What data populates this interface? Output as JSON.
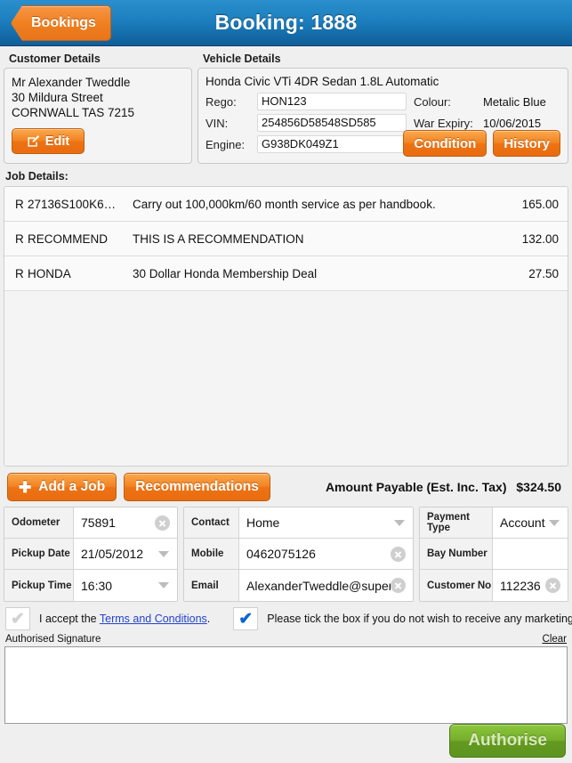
{
  "header": {
    "back_label": "Bookings",
    "title": "Booking: 1888"
  },
  "customer": {
    "panel_title": "Customer Details",
    "name": "Mr Alexander Tweddle",
    "street": "30 Mildura Street",
    "city_line": "CORNWALL TAS 7215",
    "edit_label": "Edit"
  },
  "vehicle": {
    "panel_title": "Vehicle Details",
    "description": "Honda Civic VTi 4DR Sedan 1.8L Automatic",
    "rego_label": "Rego:",
    "rego_value": "HON123",
    "vin_label": "VIN:",
    "vin_value": "254856D58548SD585",
    "engine_label": "Engine:",
    "engine_value": "G938DK049Z1",
    "colour_label": "Colour:",
    "colour_value": "Metalic Blue",
    "war_expiry_label": "War Expiry:",
    "war_expiry_value": "10/06/2015",
    "condition_label": "Condition",
    "history_label": "History"
  },
  "jobs": {
    "heading": "Job Details:",
    "rows": [
      {
        "flag": "R",
        "code": "27136S100K6…",
        "description": "Carry out 100,000km/60 month service as per handbook.",
        "price": "165.00"
      },
      {
        "flag": "R",
        "code": "RECOMMEND",
        "description": "THIS IS A RECOMMENDATION",
        "price": "132.00"
      },
      {
        "flag": "R",
        "code": "HONDA",
        "description": "30 Dollar Honda Membership Deal",
        "price": "27.50"
      }
    ]
  },
  "actions": {
    "add_job_label": "Add a Job",
    "add_job_icon": "plus-icon",
    "recommendations_label": "Recommendations",
    "amount_label": "Amount Payable (Est. Inc. Tax)",
    "amount_value": "$324.50"
  },
  "form": {
    "col1": [
      {
        "label": "Odometer",
        "value": "75891",
        "control": "clear"
      },
      {
        "label": "Pickup Date",
        "value": "21/05/2012",
        "control": "dropdown"
      },
      {
        "label": "Pickup Time",
        "value": "16:30",
        "control": "dropdown"
      }
    ],
    "col2": [
      {
        "label": "Contact",
        "value": "Home",
        "control": "dropdown"
      },
      {
        "label": "Mobile",
        "value": "0462075126",
        "control": "clear"
      },
      {
        "label": "Email",
        "value": "AlexanderTweddle@super",
        "control": "clear"
      }
    ],
    "col3": [
      {
        "label": "Payment Type",
        "value": "Account",
        "control": "dropdown"
      },
      {
        "label": "Bay Number",
        "value": "",
        "control": "none"
      },
      {
        "label": "Customer No",
        "value": "112236",
        "control": "clear"
      }
    ]
  },
  "terms": {
    "accept_prefix": "I accept the ",
    "accept_link": "Terms and Conditions",
    "accept_suffix": ".",
    "accept_checked": false,
    "marketing_text": "Please tick the box if you do not wish to receive any marketing material.",
    "marketing_checked": true,
    "tick_glyph": "✔"
  },
  "signature": {
    "label": "Authorised Signature",
    "clear_label": "Clear"
  },
  "footer": {
    "authorise_label": "Authorise"
  }
}
